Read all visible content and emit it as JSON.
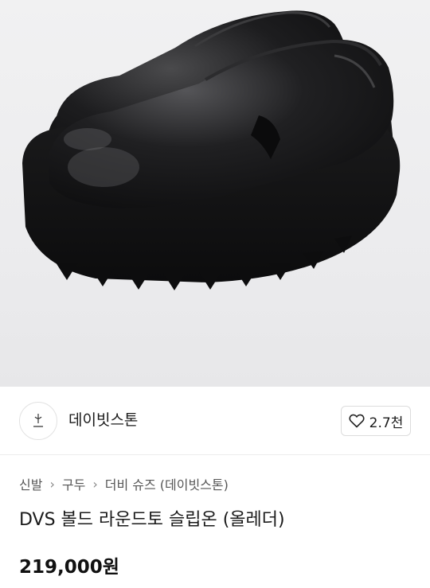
{
  "product_image": {
    "alt": ""
  },
  "brand": {
    "name": "데이빗스톤",
    "logo_icon": "brand-logo-icon"
  },
  "wishlist": {
    "count": "2.7천",
    "icon": "heart-outline-icon"
  },
  "breadcrumb": [
    "신발",
    "구두",
    "더비 슈즈 (데이빗스톤)"
  ],
  "product": {
    "title": "DVS 볼드 라운드토 슬립온 (올레더)",
    "price": "219,000원"
  }
}
